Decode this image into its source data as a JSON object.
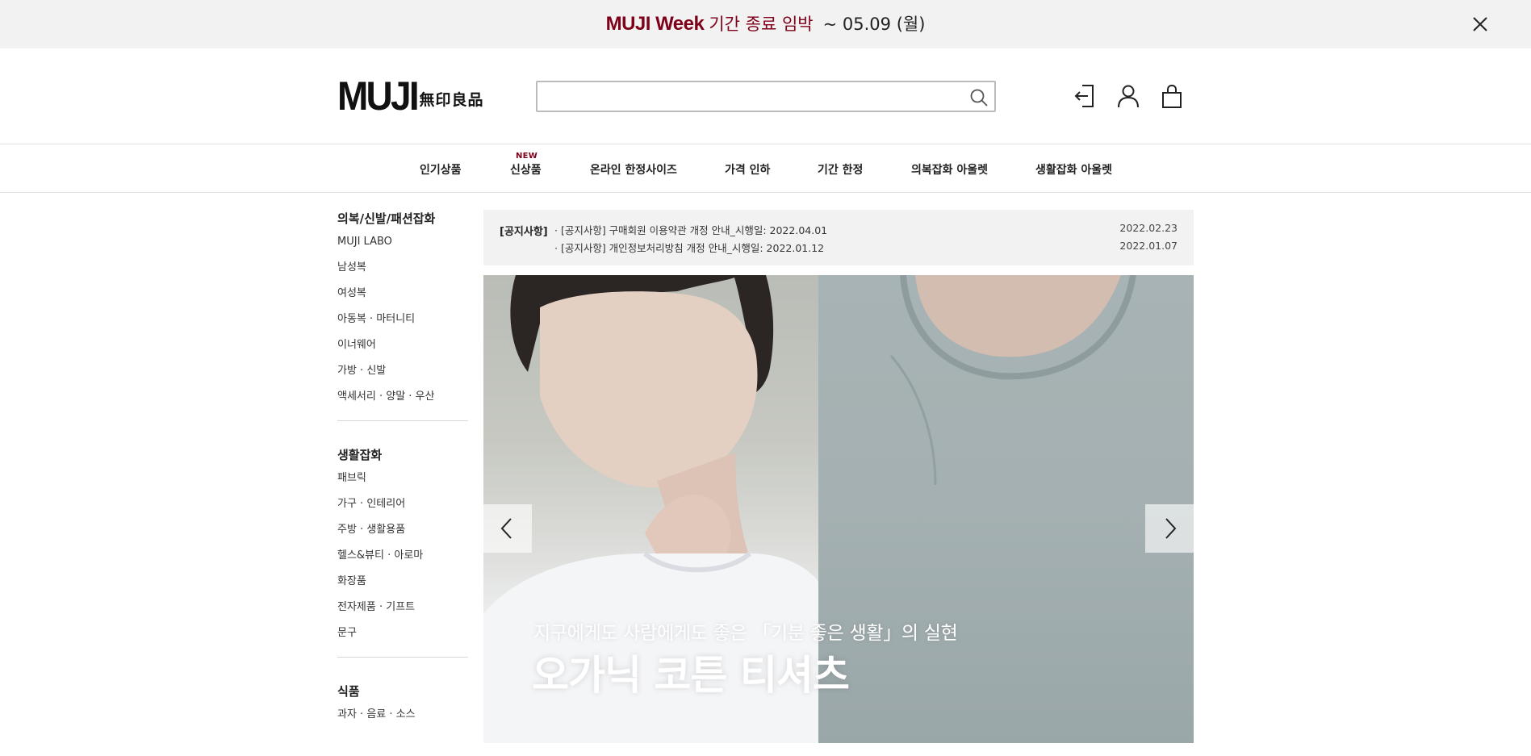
{
  "promo": {
    "brand": "MUJI Week",
    "message": "기간 종료 임박",
    "date": "~ 05.09 (월)",
    "icon": "close-icon"
  },
  "header": {
    "logo_main": "MUJI",
    "logo_sub": "無印良品",
    "search_value": "",
    "icons": [
      "search-icon",
      "login-icon",
      "user-icon",
      "cart-icon"
    ]
  },
  "nav": {
    "items": [
      {
        "label": "인기상품",
        "badge": ""
      },
      {
        "label": "신상품",
        "badge": "NEW"
      },
      {
        "label": "온라인 한정사이즈",
        "badge": ""
      },
      {
        "label": "가격 인하",
        "badge": ""
      },
      {
        "label": "기간 한정",
        "badge": ""
      },
      {
        "label": "의복잡화 아울렛",
        "badge": ""
      },
      {
        "label": "생활잡화 아울렛",
        "badge": ""
      }
    ]
  },
  "sidebar": {
    "sections": [
      {
        "heading": "의복/신발/패션잡화",
        "items": [
          "MUJI LABO",
          "남성복",
          "여성복",
          "아동복 · 마터니티",
          "이너웨어",
          "가방 · 신발",
          "액세서리 · 양말 · 우산"
        ]
      },
      {
        "heading": "생활잡화",
        "items": [
          "패브릭",
          "가구 · 인테리어",
          "주방 · 생활용품",
          "헬스&뷰티 · 아로마",
          "화장품",
          "전자제품 · 기프트",
          "문구"
        ]
      },
      {
        "heading": "식품",
        "items": [
          "과자 · 음료 · 소스"
        ]
      }
    ]
  },
  "notice": {
    "label": "[공지사항]",
    "rows": [
      {
        "title": "· [공지사항] 구매회원 이용약관 개정 안내_시행일: 2022.04.01",
        "date": "2022.02.23"
      },
      {
        "title": "· [공지사항] 개인정보처리방침 개정 안내_시행일: 2022.01.12",
        "date": "2022.01.07"
      }
    ]
  },
  "hero": {
    "subtitle": "지구에게도 사람에게도 좋은 「기분 좋은 생활」의 실현",
    "title": "오가닉 코튼 티셔츠",
    "icons": [
      "chevron-left-icon",
      "chevron-right-icon"
    ]
  },
  "colors": {
    "accent": "#7f0019",
    "banner_bg": "#f2f2f2",
    "notice_bg": "#f2f2f2"
  }
}
